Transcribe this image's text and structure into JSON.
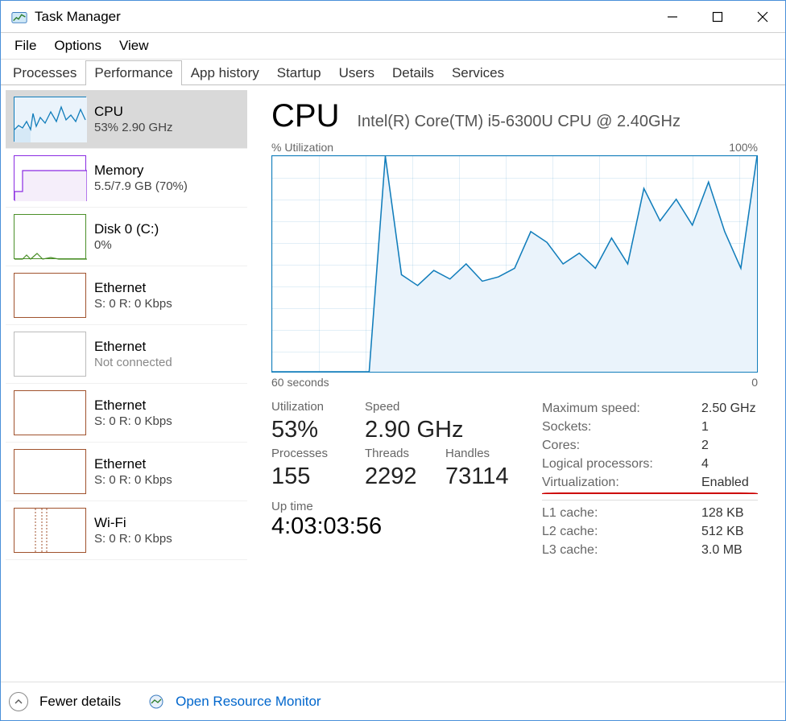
{
  "window": {
    "title": "Task Manager"
  },
  "menu": [
    "File",
    "Options",
    "View"
  ],
  "tab_names": [
    "Processes",
    "Performance",
    "App history",
    "Startup",
    "Users",
    "Details",
    "Services"
  ],
  "active_tab_index": 1,
  "sidebar": [
    {
      "name": "CPU",
      "sub": "53%  2.90 GHz",
      "selected": true,
      "color": "#117dbb",
      "thumb": "cpu"
    },
    {
      "name": "Memory",
      "sub": "5.5/7.9 GB (70%)",
      "selected": false,
      "color": "#8a2be2",
      "thumb": "mem"
    },
    {
      "name": "Disk 0 (C:)",
      "sub": "0%",
      "selected": false,
      "color": "#4b8f29",
      "thumb": "disk"
    },
    {
      "name": "Ethernet",
      "sub": "S: 0  R: 0 Kbps",
      "selected": false,
      "color": "#a0522d",
      "thumb": "flat"
    },
    {
      "name": "Ethernet",
      "sub": "Not connected",
      "selected": false,
      "dim": true,
      "color": "#bbb",
      "thumb": "flat"
    },
    {
      "name": "Ethernet",
      "sub": "S: 0  R: 0 Kbps",
      "selected": false,
      "color": "#a0522d",
      "thumb": "flat"
    },
    {
      "name": "Ethernet",
      "sub": "S: 0  R: 0 Kbps",
      "selected": false,
      "color": "#a0522d",
      "thumb": "flat"
    },
    {
      "name": "Wi-Fi",
      "sub": "S: 0  R: 0 Kbps",
      "selected": false,
      "color": "#a0522d",
      "thumb": "wifi"
    }
  ],
  "main": {
    "title": "CPU",
    "model": "Intel(R) Core(TM) i5-6300U CPU @ 2.40GHz",
    "chart_top_left": "% Utilization",
    "chart_top_right": "100%",
    "chart_bottom_left": "60 seconds",
    "chart_bottom_right": "0",
    "left_stats": {
      "utilization": {
        "label": "Utilization",
        "value": "53%"
      },
      "speed": {
        "label": "Speed",
        "value": "2.90 GHz"
      },
      "processes": {
        "label": "Processes",
        "value": "155"
      },
      "threads": {
        "label": "Threads",
        "value": "2292"
      },
      "handles": {
        "label": "Handles",
        "value": "73114"
      },
      "uptime": {
        "label": "Up time",
        "value": "4:03:03:56"
      }
    },
    "right_stats": [
      {
        "label": "Maximum speed:",
        "value": "2.50 GHz"
      },
      {
        "label": "Sockets:",
        "value": "1"
      },
      {
        "label": "Cores:",
        "value": "2"
      },
      {
        "label": "Logical processors:",
        "value": "4"
      },
      {
        "label": "Virtualization:",
        "value": "Enabled",
        "annot": true
      },
      {
        "label": "L1 cache:",
        "value": "128 KB"
      },
      {
        "label": "L2 cache:",
        "value": "512 KB"
      },
      {
        "label": "L3 cache:",
        "value": "3.0 MB"
      }
    ]
  },
  "footer": {
    "fewer": "Fewer details",
    "resmon": "Open Resource Monitor"
  },
  "chart_data": {
    "type": "line",
    "title": "CPU % Utilization",
    "xlabel": "seconds ago (60→0)",
    "ylabel": "% Utilization",
    "ylim": [
      0,
      100
    ],
    "x": [
      60,
      58,
      56,
      54,
      52,
      50,
      48,
      46,
      44,
      42,
      40,
      38,
      36,
      34,
      32,
      30,
      28,
      26,
      24,
      22,
      20,
      18,
      16,
      14,
      12,
      10,
      8,
      6,
      4,
      2,
      0
    ],
    "values": [
      0,
      0,
      0,
      0,
      0,
      0,
      0,
      100,
      45,
      40,
      47,
      43,
      50,
      42,
      44,
      48,
      65,
      60,
      50,
      55,
      48,
      62,
      50,
      85,
      70,
      80,
      68,
      88,
      65,
      48,
      100
    ]
  }
}
